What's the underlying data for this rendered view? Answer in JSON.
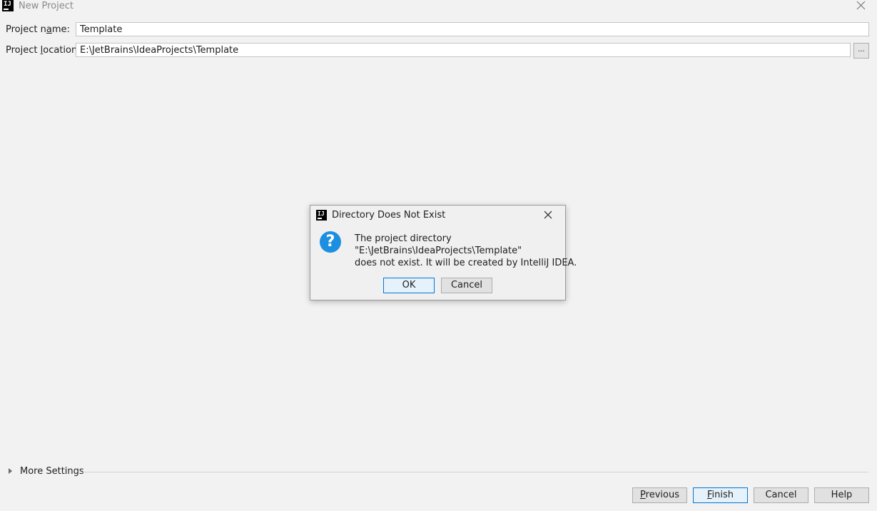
{
  "window": {
    "title": "New Project",
    "logo_text": "IJ"
  },
  "form": {
    "project_name_label_pre": "Project n",
    "project_name_label_mnemonic": "a",
    "project_name_label_post": "me:",
    "project_name_value": "Template",
    "project_location_label_pre": "Project ",
    "project_location_label_mnemonic": "l",
    "project_location_label_post": "ocation:",
    "project_location_value": "E:\\JetBrains\\IdeaProjects\\Template",
    "browse_label": "..."
  },
  "more_settings": {
    "label": "More Settings"
  },
  "footer": {
    "previous_mnemonic": "P",
    "previous_rest": "revious",
    "finish_mnemonic": "F",
    "finish_rest": "inish",
    "cancel_label": "Cancel",
    "help_label": "Help"
  },
  "dialog": {
    "title": "Directory Does Not Exist",
    "logo_text": "IJ",
    "icon": "question-icon",
    "icon_glyph": "?",
    "message_lines": [
      "The project directory",
      "\"E:\\JetBrains\\IdeaProjects\\Template\"",
      "does not exist. It will be created by IntelliJ IDEA."
    ],
    "ok_label": "OK",
    "cancel_label": "Cancel"
  },
  "colors": {
    "background": "#f2f2f2",
    "accent": "#0078d7",
    "question_icon": "#1c8fe0"
  }
}
